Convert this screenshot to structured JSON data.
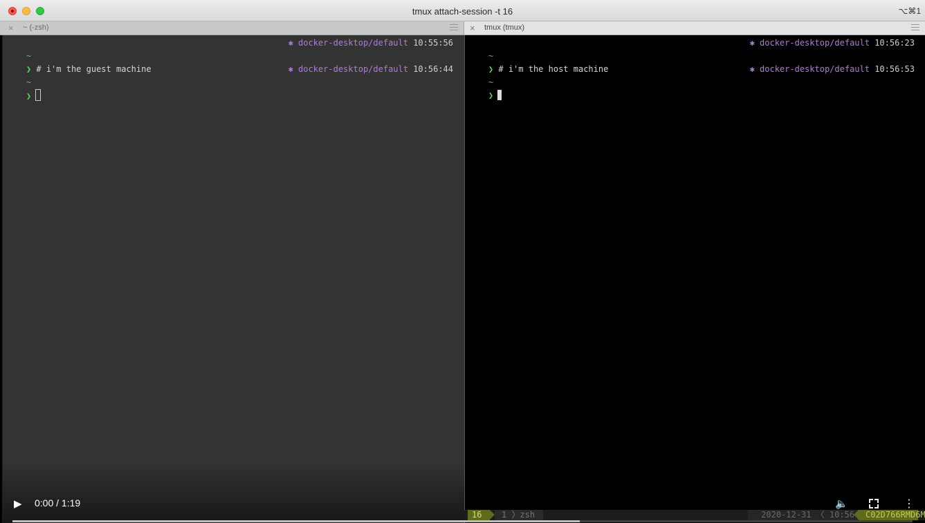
{
  "window": {
    "title": "tmux attach-session -t 16",
    "shortcut": "⌥⌘1"
  },
  "tabs": [
    {
      "label": "~ (-zsh)"
    },
    {
      "label": "tmux (tmux)"
    }
  ],
  "left_pane": {
    "lines": [
      {
        "dir": "~",
        "rprompt_ctx": "✱ docker-desktop/default",
        "rprompt_time": "10:55:56"
      },
      {
        "prompt": "❯",
        "command": "# i'm the guest machine"
      },
      {
        "dir": "~",
        "rprompt_ctx": "✱ docker-desktop/default",
        "rprompt_time": "10:56:44"
      },
      {
        "prompt": "❯",
        "command": ""
      }
    ]
  },
  "right_pane": {
    "lines": [
      {
        "dir": "~",
        "rprompt_ctx": "✱ docker-desktop/default",
        "rprompt_time": "10:56:23"
      },
      {
        "prompt": "❯",
        "command": "# i'm the host machine"
      },
      {
        "dir": "~",
        "rprompt_ctx": "✱ docker-desktop/default",
        "rprompt_time": "10:56:53"
      },
      {
        "prompt": "❯",
        "command": ""
      }
    ]
  },
  "video": {
    "play_icon": "▶",
    "time": "0:00 / 1:19",
    "volume_icon": "🔈",
    "more_icon": "⋮",
    "progress_fraction": 0.63
  },
  "statusbar": {
    "session": "16",
    "window": "1 〉zsh",
    "date": "2020-12-31 〈 10:56",
    "host": "C02D766RMD6M"
  },
  "colors": {
    "guest_bg": "#333333",
    "host_bg": "#000000",
    "prompt": "#5fd75f",
    "context": "#b07ad9",
    "tmux_green": "#5f6a1a"
  }
}
